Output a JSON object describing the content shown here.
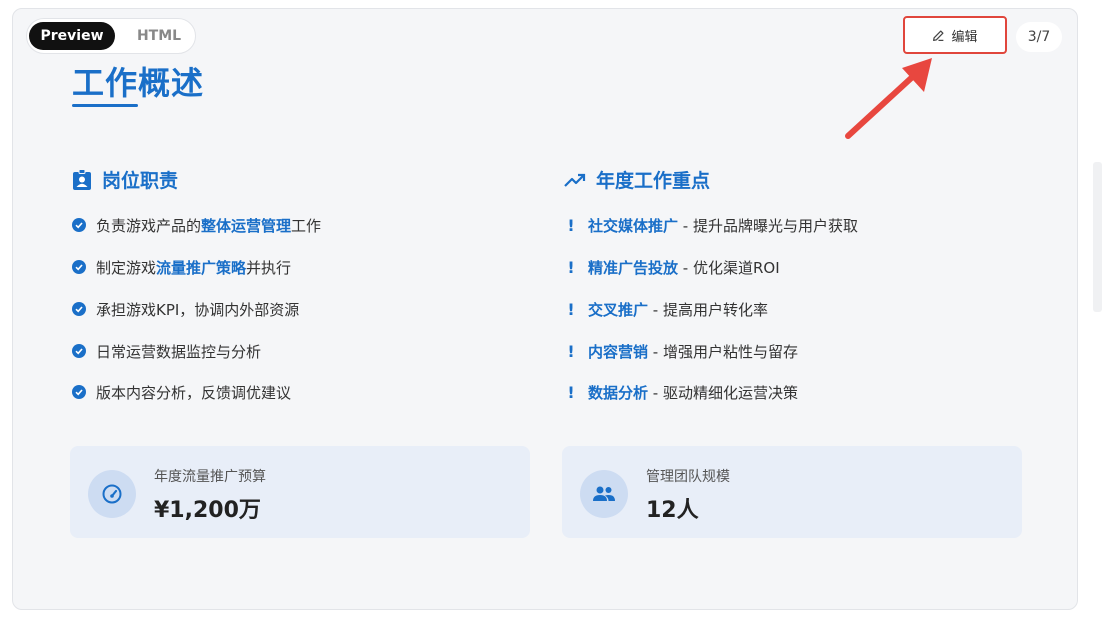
{
  "toggle": {
    "preview_label": "Preview",
    "html_label": "HTML"
  },
  "toolbar": {
    "edit_label": "编辑",
    "pager": "3/7"
  },
  "page": {
    "title": "工作概述"
  },
  "duties": {
    "heading": "岗位职责",
    "items": [
      {
        "pre": "负责游戏产品的",
        "hl": "整体运营管理",
        "post": "工作"
      },
      {
        "pre": "制定游戏",
        "hl": "流量推广策略",
        "post": "并执行"
      },
      {
        "pre": "承担游戏KPI，协调内外部资源",
        "hl": "",
        "post": ""
      },
      {
        "pre": "日常运营数据监控与分析",
        "hl": "",
        "post": ""
      },
      {
        "pre": "版本内容分析，反馈调优建议",
        "hl": "",
        "post": ""
      }
    ]
  },
  "focus": {
    "heading": "年度工作重点",
    "items": [
      {
        "hl": "社交媒体推广",
        "post": " - 提升品牌曝光与用户获取"
      },
      {
        "hl": "精准广告投放",
        "post": " - 优化渠道ROI"
      },
      {
        "hl": "交叉推广",
        "post": " - 提高用户转化率"
      },
      {
        "hl": "内容营销",
        "post": " - 增强用户粘性与留存"
      },
      {
        "hl": "数据分析",
        "post": " - 驱动精细化运营决策"
      }
    ]
  },
  "stats": {
    "budget": {
      "label": "年度流量推广预算",
      "value": "¥1,200万",
      "icon": "speedometer-icon"
    },
    "team": {
      "label": "管理团队规模",
      "value": "12人",
      "icon": "people-icon"
    }
  },
  "colors": {
    "accent": "#1a6fc8",
    "annotation": "#e0463c"
  }
}
